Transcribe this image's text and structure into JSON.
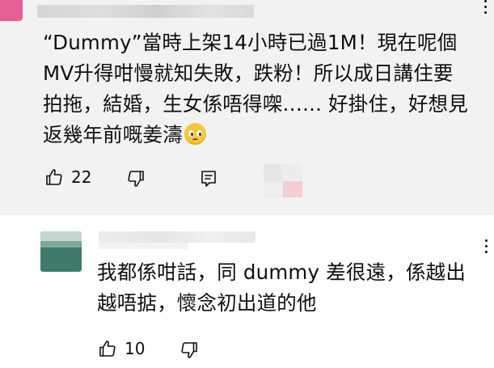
{
  "comments": [
    {
      "text": "“Dummy”當時上架14小時已過1M！現在呢個\nMV升得咁慢就知失敗，跌粉！所以成日講住要\n拍拖，結婚，生女係唔得㗎…... 好掛住，好想見\n返幾年前嘅姜濤",
      "emoji": "pleading-face-emoji",
      "likes": "22",
      "icons": {
        "like": "thumbs-up-icon",
        "dislike": "thumbs-down-icon",
        "reply": "reply-icon",
        "more": "more-vert-icon"
      }
    },
    {
      "text": "我都係咁話，同 dummy 差很遠，係越出\n越唔掂，懷念初出道的他",
      "likes": "10",
      "icons": {
        "like": "thumbs-up-icon",
        "dislike": "thumbs-down-icon",
        "more": "more-vert-icon"
      }
    }
  ],
  "colors": {
    "comment_bg": "#f2f2f2",
    "text": "#0f0f0f",
    "avatar_pink": "#e45f95",
    "avatar_green": "#3f7a6c"
  }
}
